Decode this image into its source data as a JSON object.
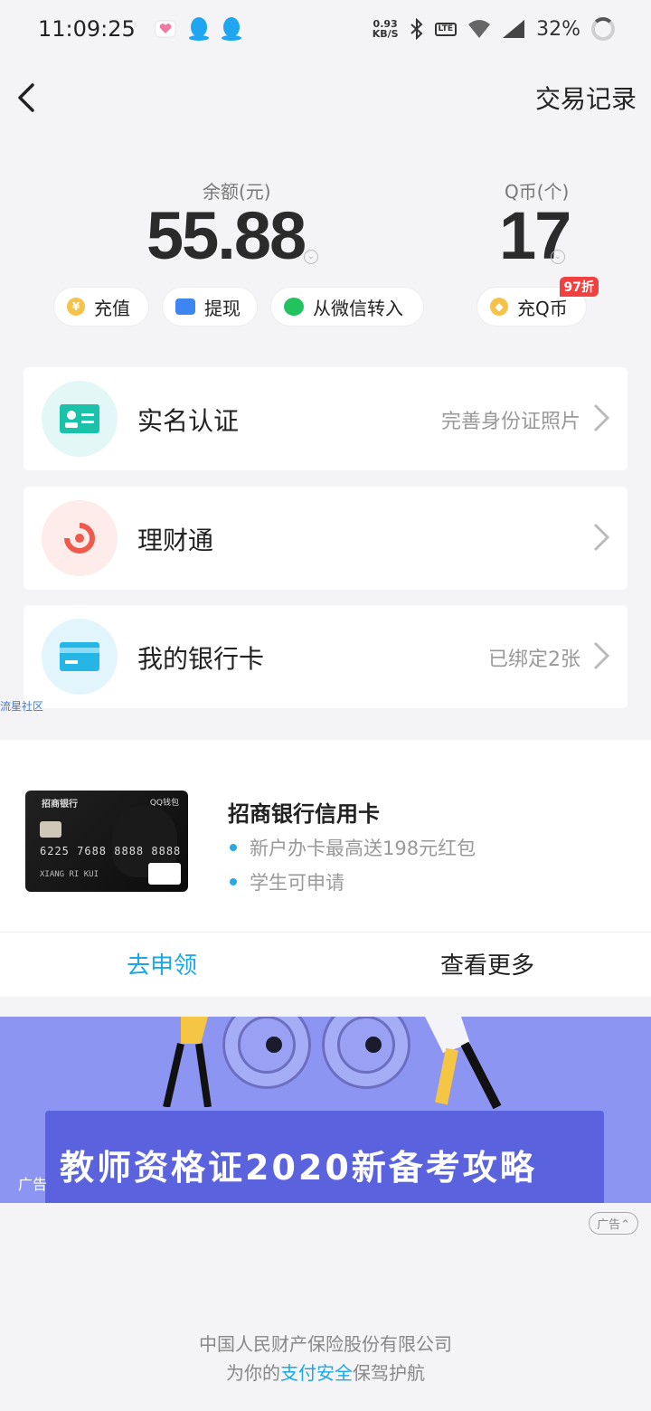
{
  "status_bar": {
    "time": "11:09:25",
    "speed_value": "0.93",
    "speed_unit": "KB/S",
    "volte": "LTE",
    "battery": "32%"
  },
  "nav": {
    "title": "交易记录"
  },
  "balance": {
    "label": "余额(元)",
    "value": "55.88"
  },
  "qcoin": {
    "label": "Q币(个)",
    "value": "17"
  },
  "actions": {
    "recharge": "充值",
    "withdraw": "提现",
    "from_wechat": "从微信转入",
    "recharge_qcoin": "充Q币",
    "discount": "97折"
  },
  "cards": [
    {
      "title": "实名认证",
      "subtitle": "完善身份证照片"
    },
    {
      "title": "理财通",
      "subtitle": ""
    },
    {
      "title": "我的银行卡",
      "subtitle": "已绑定2张"
    }
  ],
  "watermark": "流星社区",
  "ad": {
    "title": "招商银行信用卡",
    "bullets": [
      "新户办卡最高送198元红包",
      "学生可申请"
    ],
    "apply": "去申领",
    "more": "查看更多",
    "card_bank": "招商银行",
    "card_wallet": "QQ钱包",
    "card_number": "6225 7688 8888 8888",
    "card_holder": "XIANG RI KUI"
  },
  "banner": {
    "text": "教师资格证2020新备考攻略",
    "ad_label": "广告"
  },
  "ad_tag": "广告⌃",
  "footer": {
    "line1": "中国人民财产保险股份有限公司",
    "line2_prefix": "为你的",
    "line2_highlight": "支付安全",
    "line2_suffix": "保驾护航"
  },
  "colors": {
    "accent": "#1aa8e6",
    "banner_bg": "#8d95f3"
  }
}
